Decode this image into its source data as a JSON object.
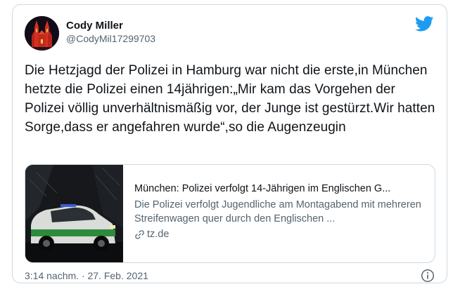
{
  "author": {
    "name": "Cody Miller",
    "handle": "@CodyMil17299703",
    "avatar_icon": "avatar-cathedral-photo"
  },
  "tweet_text": "Die Hetzjagd der Polizei in Hamburg war nicht die erste,in München hetzte die Polizei einen 14jährigen:„Mir kam das Vorgehen der Polizei völlig unverhältnismäßig vor, der Junge ist gestürzt.Wir hatten Sorge,dass er angefahren wurde“,so die Augenzeugin",
  "card": {
    "title": "München: Polizei verfolgt 14-Jährigen im Englischen G...",
    "description": "Die Polizei verfolgt Jugendliche am Montagabend mit mehreren Streifenwagen quer durch den Englischen ...",
    "domain": "tz.de",
    "image_icon": "police-car-photo"
  },
  "timestamp": "3:14 nachm. · 27. Feb. 2021",
  "colors": {
    "brand_blue": "#1d9bf0",
    "text": "#0f1419",
    "secondary": "#536471",
    "border": "#cfd9de"
  },
  "icons": {
    "brand": "twitter-bird-icon",
    "link": "link-icon",
    "info": "info-icon"
  }
}
